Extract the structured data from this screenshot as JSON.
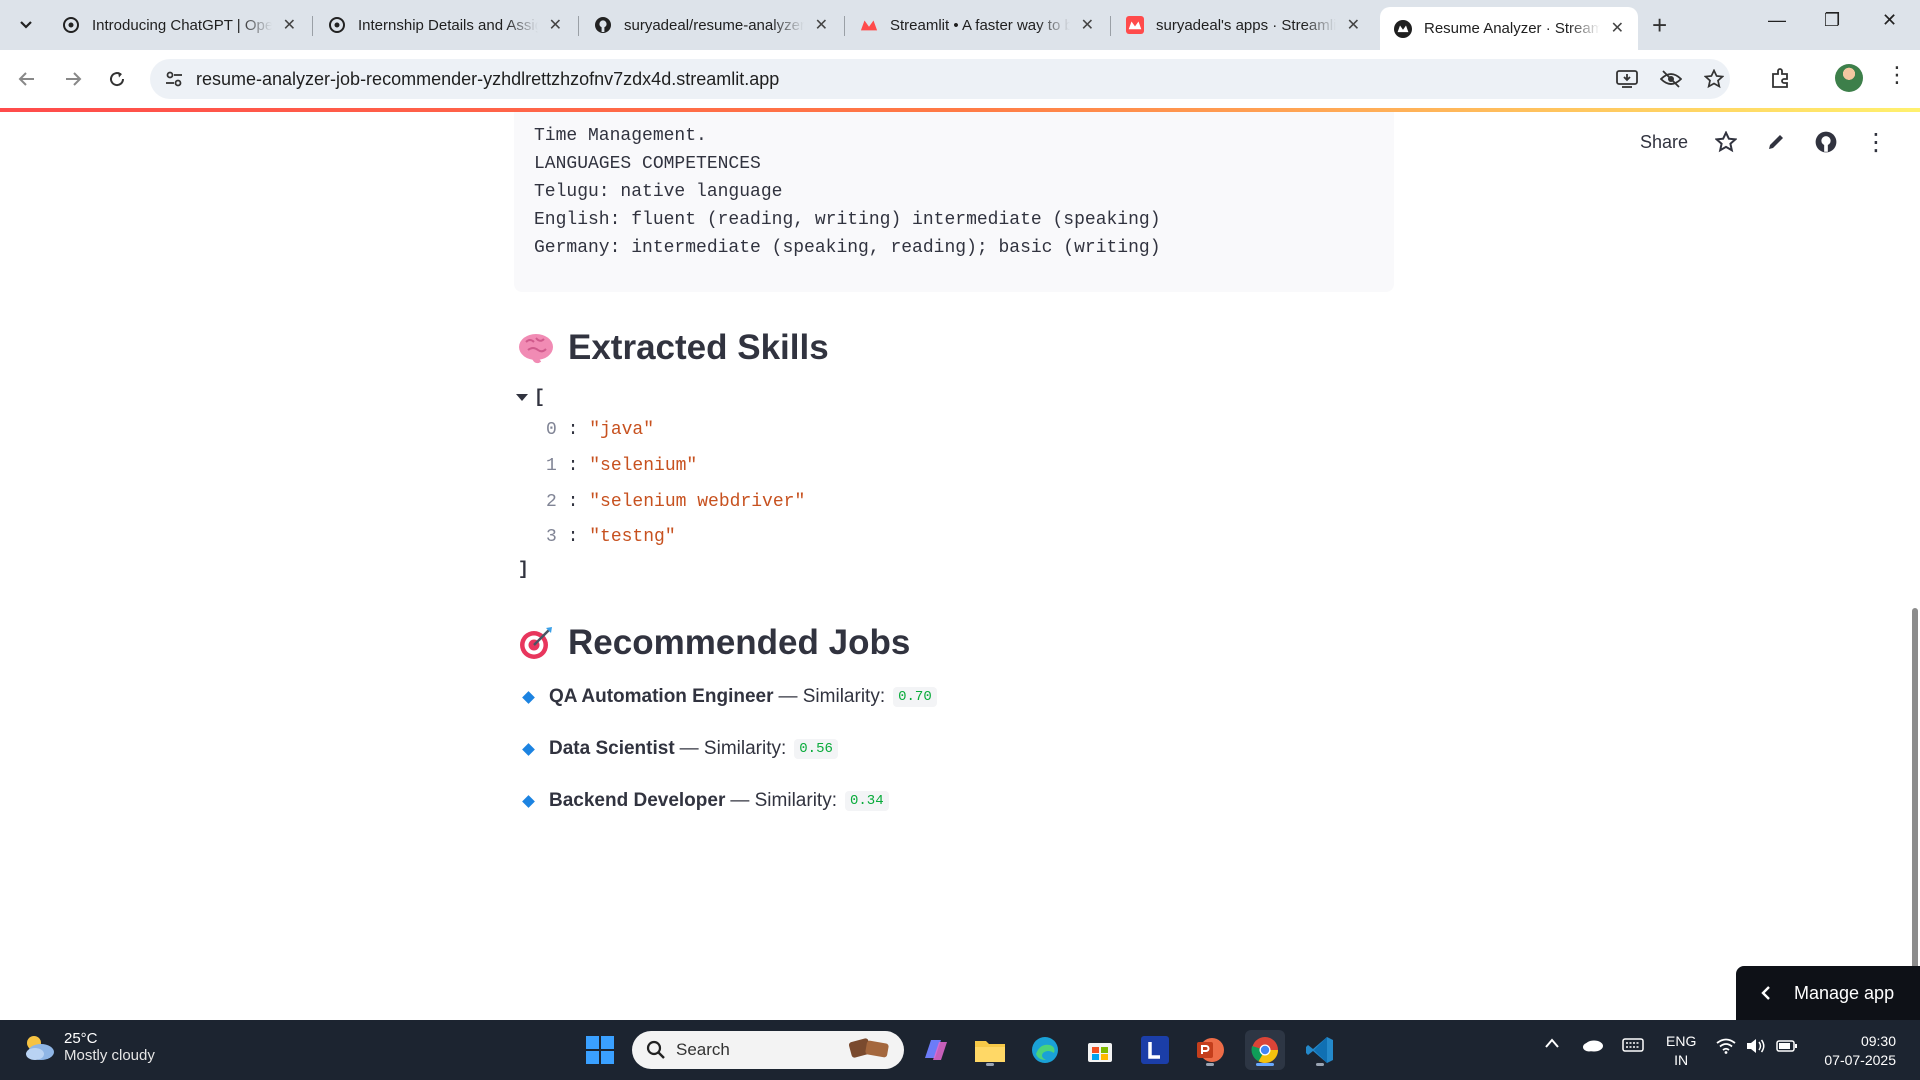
{
  "browser": {
    "tabs": [
      {
        "title": "Introducing ChatGPT | OpenAI",
        "favicon": "openai-icon"
      },
      {
        "title": "Internship Details and Assignment",
        "favicon": "openai-icon"
      },
      {
        "title": "suryadeal/resume-analyzer-job",
        "favicon": "github-icon"
      },
      {
        "title": "Streamlit • A faster way to build",
        "favicon": "streamlit-icon"
      },
      {
        "title": "suryadeal's apps · Streamlit",
        "favicon": "streamlit-icon"
      },
      {
        "title": "Resume Analyzer · Streamlit",
        "favicon": "streamlit-dark-icon",
        "active": true
      }
    ],
    "url": "resume-analyzer-job-recommender-yzhdlrettzhzofnv7zdx4d.streamlit.app"
  },
  "header": {
    "share_label": "Share"
  },
  "resume_text_tail": [
    "Time Management.",
    "LANGUAGES COMPETENCES",
    "Telugu: native language",
    "English: fluent (reading, writing) intermediate (speaking)",
    "Germany: intermediate (speaking, reading); basic (writing)"
  ],
  "skills_section": {
    "title": "Extracted Skills",
    "emoji": "brain",
    "open_bracket": "[",
    "close_bracket": "]",
    "items": [
      {
        "index": "0",
        "value": "\"java\""
      },
      {
        "index": "1",
        "value": "\"selenium\""
      },
      {
        "index": "2",
        "value": "\"selenium webdriver\""
      },
      {
        "index": "3",
        "value": "\"testng\""
      }
    ]
  },
  "jobs_section": {
    "title": "Recommended Jobs",
    "emoji": "direct-hit",
    "similarity_label": "— Similarity:",
    "jobs": [
      {
        "title": "QA Automation Engineer",
        "similarity": "0.70"
      },
      {
        "title": "Data Scientist",
        "similarity": "0.56"
      },
      {
        "title": "Backend Developer",
        "similarity": "0.34"
      }
    ]
  },
  "manage_app_label": "Manage app",
  "taskbar": {
    "weather_temp": "25°C",
    "weather_desc": "Mostly cloudy",
    "search_placeholder": "Search",
    "lang_top": "ENG",
    "lang_bottom": "IN",
    "time": "09:30",
    "date": "07-07-2025"
  },
  "colors": {
    "accent_streamlit": "#ff4b4b",
    "json_string": "#c7511f",
    "similarity_code": "#09ab3b",
    "bullet": "#1c83e1"
  }
}
